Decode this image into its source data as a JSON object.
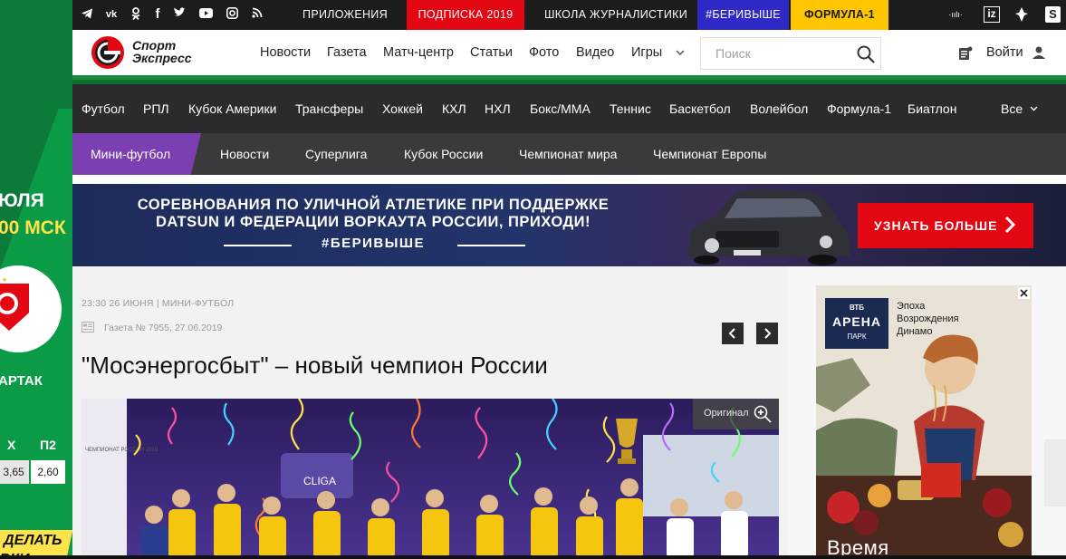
{
  "colors": {
    "topbar_bg": "#1c1c1c",
    "subscription_red": "#e30613",
    "hashtag_blue": "#2d2ac8",
    "formula_yellow": "#ffc600",
    "brand_green": "#1a8a3a",
    "sportsbar_bg": "#2b2b2d",
    "subnav_active": "#7b3fb1",
    "article_bg": "#f2f2f2"
  },
  "left_ad": {
    "date": "ЮЛЯ",
    "time": "00 МСК",
    "team": "АРТАК",
    "col_x": "Х",
    "col_p2": "П2",
    "odd_x": "3,65",
    "odd_p2": "2,60",
    "cta_line1": "ДЕЛАТЬ",
    "cta_line2": "ВКИ"
  },
  "topbar": {
    "social_icons": [
      "telegram-icon",
      "vk-icon",
      "odnoklassniki-icon",
      "facebook-icon",
      "twitter-icon",
      "youtube-icon",
      "instagram-icon",
      "rss-icon"
    ],
    "links": [
      {
        "label": "ПРИЛОЖЕНИЯ"
      },
      {
        "label": "ПОДПИСКА 2019"
      },
      {
        "label": "ШКОЛА ЖУРНАЛИСТИКИ"
      },
      {
        "label": "#БЕРИВЫШЕ"
      },
      {
        "label": "ФОРМУЛА-1"
      }
    ],
    "right": {
      "audio": "·ıılı·",
      "iz": "iz",
      "s": "S"
    }
  },
  "header": {
    "logo_line1": "Спорт",
    "logo_line2": "Экспресс",
    "nav": [
      "Новости",
      "Газета",
      "Матч-центр",
      "Статьи",
      "Фото",
      "Видео",
      "Игры"
    ],
    "more_chevron": "chevron-down-icon",
    "search_placeholder": "Поиск",
    "login": "Войти"
  },
  "sports": [
    "Футбол",
    "РПЛ",
    "Кубок Америки",
    "Трансферы",
    "Хоккей",
    "КХЛ",
    "НХЛ",
    "Бокс/ММА",
    "Теннис",
    "Баскетбол",
    "Волейбол",
    "Формула-1",
    "Биатлон",
    "Все"
  ],
  "subnav": {
    "active": "Мини-футбол",
    "items": [
      "Новости",
      "Суперлига",
      "Кубок России",
      "Чемпионат мира",
      "Чемпионат Европы"
    ]
  },
  "banner": {
    "line1": "СОРЕВНОВАНИЯ ПО УЛИЧНОЙ АТЛЕТИКЕ ПРИ ПОДДЕРЖКЕ",
    "line2": "DATSUN И ФЕДЕРАЦИИ ВОРКАУТА РОССИИ, ПРИХОДИ!",
    "hashtag": "#БЕРИВЫШЕ",
    "button": "УЗНАТЬ БОЛЬШЕ"
  },
  "article": {
    "meta": "23:30 26 ИЮНЯ | МИНИ-ФУТБОЛ",
    "issue": "Газета № 7955, 27.06.2019",
    "title": "\"Мосэнергосбыт\" – новый чемпион России",
    "photo_original": "Оригинал",
    "photo_banner_text": "ЧЕМПИОНАТ РОССИИ 2019",
    "photo_backdrop": "CLIGA"
  },
  "right_ad": {
    "brand_small": "ВТБ",
    "brand_big": "АРЕНА",
    "brand_sub": "ПАРК",
    "slogan": "Эпоха Возрождения Динамо",
    "bottom_text": "Время"
  }
}
